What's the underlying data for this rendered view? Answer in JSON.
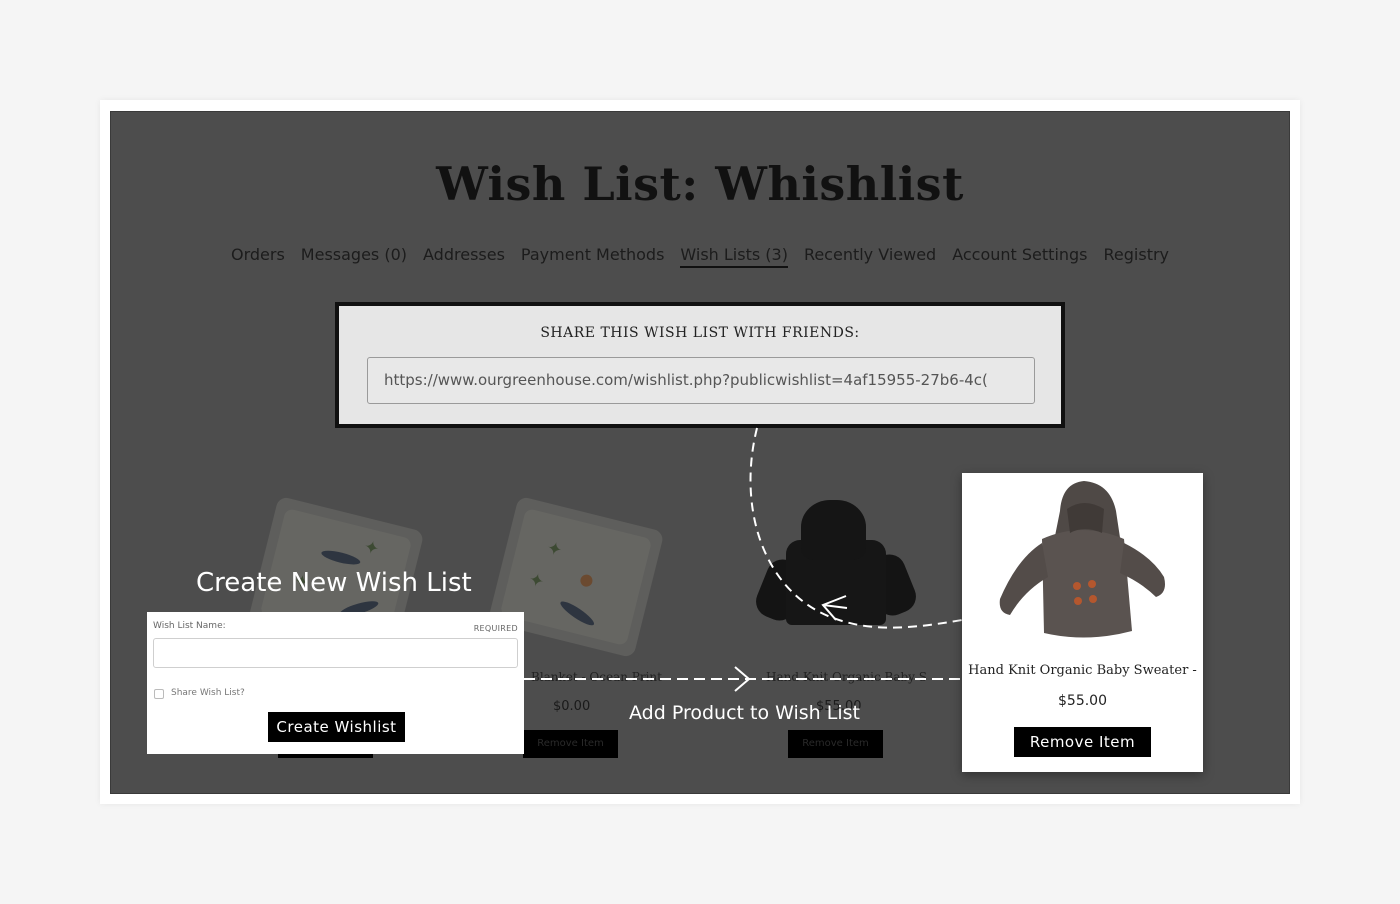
{
  "page": {
    "title": "Wish List: Whishlist"
  },
  "account_nav": {
    "items": [
      {
        "label": "Orders"
      },
      {
        "label": "Messages (0)"
      },
      {
        "label": "Addresses"
      },
      {
        "label": "Payment Methods"
      },
      {
        "label": "Wish Lists (3)",
        "active": true
      },
      {
        "label": "Recently Viewed"
      },
      {
        "label": "Account Settings"
      },
      {
        "label": "Registry"
      }
    ]
  },
  "share": {
    "heading": "SHARE THIS WISH LIST WITH FRIENDS:",
    "url": "https://www.ourgreenhouse.com/wishlist.php?publicwishlist=4af15955-27b6-4c("
  },
  "background_products": [
    {
      "price": "$0.00",
      "remove_label": "Remove Item"
    },
    {
      "price": "$55.00",
      "remove_label": "Remove Item"
    }
  ],
  "create_list": {
    "heading": "Create New Wish List",
    "name_label": "Wish List Name:",
    "required_label": "REQUIRED",
    "share_label": "Share Wish List?",
    "button_label": "Create Wishlist"
  },
  "add_product": {
    "label": "Add Product to Wish List"
  },
  "highlighted_product": {
    "title": "Hand Knit Organic Baby Sweater -",
    "price": "$55.00",
    "remove_label": "Remove Item"
  },
  "colors": {
    "overlay": "#4d4d4d",
    "button": "#000000",
    "card": "#ffffff",
    "sweater": "#5a5350",
    "sweater_button": "#b4572e"
  },
  "icons": [
    "dashed-arrow-icon",
    "arrowhead-icon"
  ]
}
